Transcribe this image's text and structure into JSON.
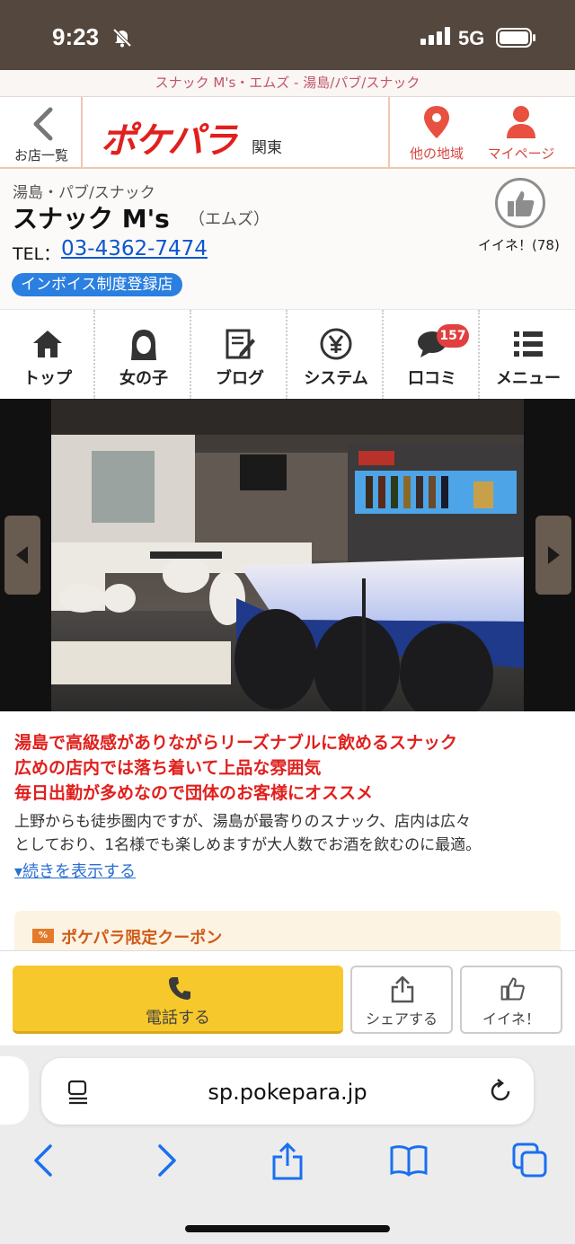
{
  "status_bar": {
    "time": "9:23",
    "network": "5G"
  },
  "page_title": "スナック M's・エムズ - 湯島/パブ/スナック",
  "header": {
    "back_label": "お店一覧",
    "logo": "ポケパラ",
    "region": "関東",
    "other_area_label": "他の地域",
    "mypage_label": "マイページ"
  },
  "shop": {
    "category": "湯島・パブ/スナック",
    "name": "スナック M's",
    "kana": "（エムズ）",
    "tel_label": "TEL：",
    "tel": "03-4362-7474",
    "invoice_badge": "インボイス制度登録店",
    "like_count": "イイネ！(78)"
  },
  "nav": {
    "items": [
      {
        "label": "トップ",
        "icon": "home-icon"
      },
      {
        "label": "女の子",
        "icon": "girl-icon"
      },
      {
        "label": "ブログ",
        "icon": "blog-icon"
      },
      {
        "label": "システム",
        "icon": "yen-icon"
      },
      {
        "label": "口コミ",
        "icon": "comment-icon",
        "badge": "157"
      },
      {
        "label": "メニュー",
        "icon": "menu-icon"
      }
    ]
  },
  "description": {
    "catch_lines": [
      "湯島で高級感がありながらリーズナブルに飲めるスナック",
      "広めの店内では落ち着いて上品な雰囲気",
      "毎日出勤が多めなので団体のお客様にオススメ"
    ],
    "body_lines": [
      "上野からも徒歩圏内ですが、湯島が最寄りのスナック、店内は広々",
      "としており、1名様でも楽しめますが大人数でお酒を飲むのに最適。"
    ],
    "more_link": "▾続きを表示する",
    "coupon_tag": "%",
    "coupon_title": "ポケパラ限定クーポン"
  },
  "actions": {
    "call_label": "電話する",
    "share_label": "シェアする",
    "like_label": "イイネ！"
  },
  "browser": {
    "url": "sp.pokepara.jp"
  },
  "colors": {
    "brand_red": "#e0201d",
    "status_bar": "#54473d",
    "call_yellow": "#f7c82b",
    "link_blue": "#0b57d0"
  }
}
